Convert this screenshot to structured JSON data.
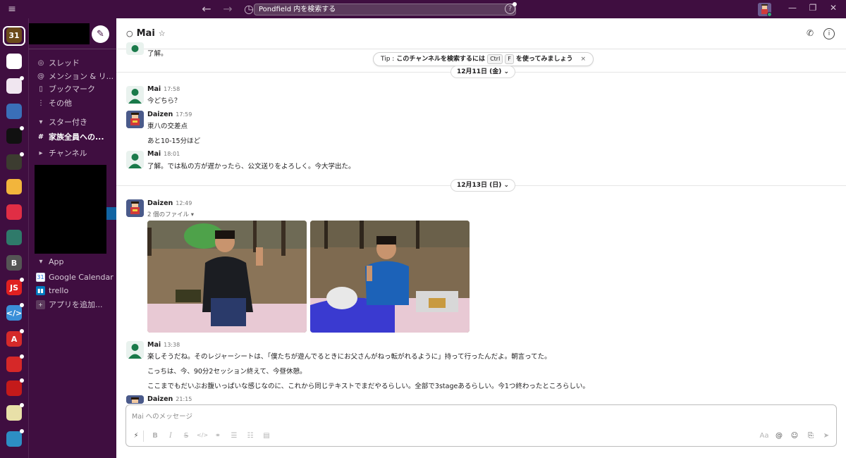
{
  "titlebar": {
    "menu_icon": "hamburger-icon",
    "search_placeholder": "Pondfield 内を検索する",
    "help_label": "?",
    "win_minimize": "—",
    "win_restore": "❐",
    "win_close": "✕"
  },
  "workspaces": [
    {
      "label": "31",
      "bg": "#6b4a1a"
    },
    {
      "label": "",
      "bg": "#ffffff"
    },
    {
      "label": "",
      "bg": "#f0e6f0"
    },
    {
      "label": "",
      "bg": "#3a6fb8"
    },
    {
      "label": "",
      "bg": "#111111"
    },
    {
      "label": "",
      "bg": "#3c3c30"
    },
    {
      "label": "",
      "bg": "#f2b53c"
    },
    {
      "label": "",
      "bg": "#e02e45"
    },
    {
      "label": "",
      "bg": "#2f7a6a"
    },
    {
      "label": "B",
      "bg": "#555555"
    },
    {
      "label": "JS",
      "bg": "#e02020"
    },
    {
      "label": "</>",
      "bg": "#3a8fd8"
    },
    {
      "label": "A",
      "bg": "#d52a2a"
    },
    {
      "label": "",
      "bg": "#d62828"
    },
    {
      "label": "",
      "bg": "#c41a1a"
    },
    {
      "label": "",
      "bg": "#e8e0a8"
    },
    {
      "label": "",
      "bg": "#2d8ec4"
    }
  ],
  "sidebar": {
    "threads": "スレッド",
    "mentions": "メンション & リ...",
    "bookmarks": "ブックマーク",
    "more": "その他",
    "starred_section": "スター付き",
    "starred_channel": "家族全員への...",
    "channels_section": "チャンネル",
    "app_section": "App",
    "apps": [
      {
        "label": "Google Calendar"
      },
      {
        "label": "trello"
      },
      {
        "label": "アプリを追加..."
      }
    ],
    "gcal_icon_text": "31"
  },
  "channel": {
    "presence": "○",
    "title": "Mai",
    "star": "☆"
  },
  "tip": {
    "prefix": "Tip : ",
    "text1": "このチャンネルを検索するには",
    "key1": "Ctrl",
    "key2": "F",
    "text2": "を使ってみましょう",
    "close": "×"
  },
  "top_partial_text": "了解。",
  "dates": {
    "d1": "12月11日 (金) ⌄",
    "d2": "12月13日 (日) ⌄"
  },
  "messages": [
    {
      "name": "Mai",
      "time": "17:58",
      "lines": [
        "今どちら？"
      ]
    },
    {
      "name": "Daizen",
      "time": "17:59",
      "lines": [
        "東八の交差点",
        "あと10-15分ほど"
      ]
    },
    {
      "name": "Mai",
      "time": "18:01",
      "lines": [
        "了解。では私の方が遅かったら、公文送りをよろしく。今大学出た。"
      ]
    },
    {
      "name": "Daizen",
      "time": "12:49",
      "files": "2 個のファイル ▾"
    },
    {
      "name": "Mai",
      "time": "13:38",
      "lines": [
        "楽しそうだね。そのレジャーシートは、「僕たちが遊んでるときにお父さんがねっ転がれるように」持って行ったんだよ。朝言ってた。",
        "こっちは、今、90分2セッション終えて、今昼休憩。",
        "ここまでもだいぶお腹いっぱいな感じなのに、これから同じテキストでまだやるらしい。全部で3stageあるらしい。今1つ終わったところらしい。"
      ]
    },
    {
      "name": "Daizen",
      "time": "21:15"
    }
  ],
  "composer": {
    "placeholder": "Mai へのメッセージ",
    "aa_label": "Aa"
  },
  "colors": {
    "aubergine": "#3f0e40",
    "active_blue": "#1164a3",
    "online_green": "#2bac76"
  }
}
